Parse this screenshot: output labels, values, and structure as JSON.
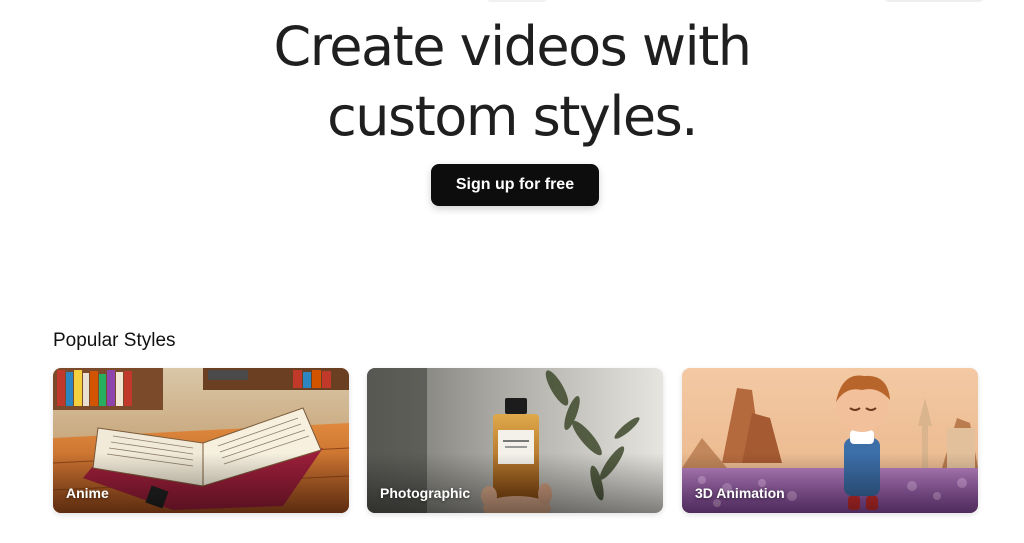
{
  "hero": {
    "title_line1": "Create videos with",
    "title_line2": "custom styles."
  },
  "cta": {
    "signup_label": "Sign up for free"
  },
  "styles_section": {
    "title": "Popular Styles",
    "cards": [
      {
        "label": "Anime",
        "image": "open-book-illustration"
      },
      {
        "label": "Photographic",
        "image": "perfume-bottle-photo"
      },
      {
        "label": "3D Animation",
        "image": "cartoon-boy-lavender-field"
      }
    ]
  },
  "colors": {
    "button_bg": "#0d0d0d",
    "button_text": "#ffffff",
    "heading_text": "#1f1f1f"
  }
}
